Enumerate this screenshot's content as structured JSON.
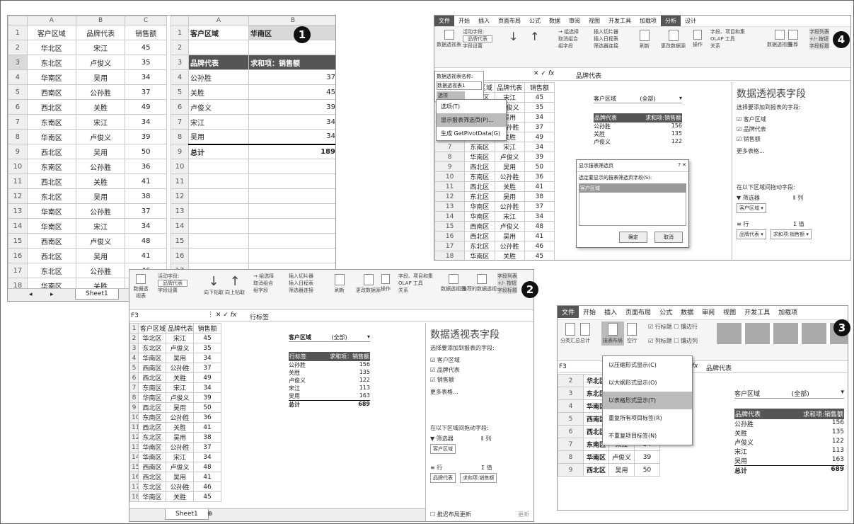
{
  "panel1": {
    "left_cols": [
      "A",
      "B",
      "C"
    ],
    "left_rows": [
      [
        "客户区域",
        "品牌代表",
        "销售额"
      ],
      [
        "华北区",
        "宋江",
        "45"
      ],
      [
        "东北区",
        "卢俊义",
        "35"
      ],
      [
        "华南区",
        "吴用",
        "34"
      ],
      [
        "西南区",
        "公孙胜",
        "37"
      ],
      [
        "西北区",
        "关胜",
        "49"
      ],
      [
        "东南区",
        "宋江",
        "34"
      ],
      [
        "华南区",
        "卢俊义",
        "39"
      ],
      [
        "西北区",
        "吴用",
        "50"
      ],
      [
        "东南区",
        "公孙胜",
        "36"
      ],
      [
        "西北区",
        "关胜",
        "41"
      ],
      [
        "东北区",
        "吴用",
        "38"
      ],
      [
        "华南区",
        "公孙胜",
        "37"
      ],
      [
        "华南区",
        "宋江",
        "34"
      ],
      [
        "西南区",
        "卢俊义",
        "48"
      ],
      [
        "西北区",
        "吴用",
        "41"
      ],
      [
        "东北区",
        "公孙胜",
        "46"
      ],
      [
        "华南区",
        "关胜",
        "45"
      ]
    ],
    "right_cols": [
      "A",
      "B"
    ],
    "right_filter": [
      "客户区域",
      "华南区"
    ],
    "right_header": [
      "品牌代表",
      "求和项：销售额"
    ],
    "right_rows": [
      [
        "公孙胜",
        "37"
      ],
      [
        "关胜",
        "45"
      ],
      [
        "卢俊义",
        "39"
      ],
      [
        "宋江",
        "34"
      ],
      [
        "吴用",
        "34"
      ]
    ],
    "right_total": [
      "总计",
      "189"
    ],
    "sheet_tab": "Sheet1",
    "badge": "1"
  },
  "panel2": {
    "namebox": "F3",
    "formula": "行标签",
    "pivot_filter": [
      "客户区域",
      "(全部)"
    ],
    "pivot_header": [
      "行标签",
      "求和项：销售额"
    ],
    "pivot_rows": [
      [
        "公孙胜",
        "156"
      ],
      [
        "关胜",
        "135"
      ],
      [
        "卢俊义",
        "122"
      ],
      [
        "宋江",
        "113"
      ],
      [
        "吴用",
        "163"
      ]
    ],
    "pivot_total": [
      "总计",
      "689"
    ],
    "pane_title": "数据透视表字段",
    "pane_sub": "选择要添加到报表的字段:",
    "fields": [
      "客户区域",
      "品牌代表",
      "销售额"
    ],
    "more": "更多表格...",
    "drag_hint": "在以下区域间拖动字段:",
    "filter_label": "筛选器",
    "col_label": "列",
    "filter_value": "客户区域",
    "row_label": "行",
    "val_label": "值",
    "row_value": "品牌代表",
    "val_value": "求和项:销售额",
    "defer": "推迟布局更新",
    "update": "更新",
    "sheet_tab": "Sheet1",
    "badge": "2"
  },
  "panel3": {
    "tabs": [
      "文件",
      "开始",
      "插入",
      "页面布局",
      "公式",
      "数据",
      "审阅",
      "视图",
      "开发工具",
      "加载项"
    ],
    "namebox": "F3",
    "formula": "品牌代表",
    "menu": [
      "以压缩形式显示(C)",
      "以大纲形式显示(O)",
      "以表格形式显示(T)",
      "重复所有项目标签(R)",
      "不重复项目标签(N)"
    ],
    "checks": [
      "行标题",
      "镶边行",
      "列标题",
      "镶边列"
    ],
    "pivot_filter": [
      "客户区域",
      "(全部)"
    ],
    "pivot_header": [
      "品牌代表",
      "求和项:销售额"
    ],
    "pivot_rows": [
      [
        "公孙胜",
        "156"
      ],
      [
        "关胜",
        "135"
      ],
      [
        "卢俊义",
        "122"
      ],
      [
        "宋江",
        "113"
      ],
      [
        "吴用",
        "163"
      ]
    ],
    "pivot_total": [
      "总计",
      "689"
    ],
    "left_rows": [
      [
        "华北区",
        ""
      ],
      [
        "东北区",
        ""
      ],
      [
        "华南区",
        ""
      ],
      [
        "西南区",
        ""
      ],
      [
        "西北区",
        ""
      ],
      [
        "东南区",
        "宋江",
        "34"
      ],
      [
        "华南区",
        "卢俊义",
        "39"
      ],
      [
        "西北区",
        "吴用",
        "50"
      ]
    ],
    "badge": "3"
  },
  "panel4": {
    "tabs": [
      "文件",
      "开始",
      "插入",
      "页面布局",
      "公式",
      "数据",
      "审阅",
      "视图",
      "开发工具",
      "加载项",
      "分析",
      "设计"
    ],
    "formula": "品牌代表",
    "name_label": "数据透视表名称:",
    "name_value": "数据透视表1",
    "opt_btn": "选项",
    "menu": [
      "选项(T)",
      "显示报表筛选页(P)...",
      "生成 GetPivotData(G)"
    ],
    "dialog_title": "显示报表筛选页",
    "dialog_label": "选定要显示的报表筛选页字段(S):",
    "dialog_item": "客户区域",
    "ok": "确定",
    "cancel": "取消",
    "pane_title": "数据透视表字段",
    "pivot_filter": [
      "客户区域",
      "(全部)"
    ],
    "pivot_header": [
      "品牌代表",
      "求和项:销售额"
    ],
    "pivot_rows": [
      [
        "公孙胜",
        "156"
      ],
      [
        "关胜",
        "135"
      ],
      [
        "卢俊义",
        "122"
      ]
    ],
    "badge": "4"
  }
}
